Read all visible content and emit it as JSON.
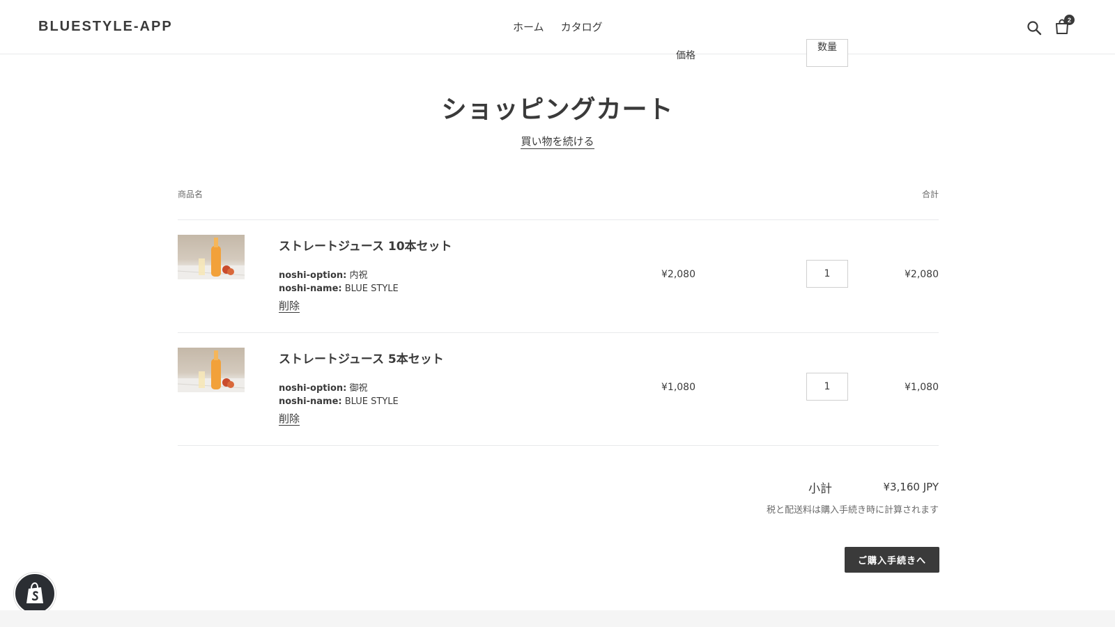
{
  "header": {
    "logo": "BLUESTYLE-APP",
    "nav": [
      "ホーム",
      "カタログ"
    ],
    "cart_count": "2",
    "icons": [
      "search-icon",
      "cart-icon"
    ]
  },
  "page": {
    "title": "ショッピングカート",
    "continue_link": "買い物を続ける"
  },
  "table": {
    "headers": {
      "name": "商品名",
      "price": "価格",
      "qty": "数量",
      "total": "合計"
    },
    "items": [
      {
        "name": "ストレートジュース 10本セット",
        "opt1_label": "noshi-option:",
        "opt1_value": "内祝",
        "opt2_label": "noshi-name:",
        "opt2_value": "BLUE STYLE",
        "remove": "削除",
        "price": "¥2,080",
        "qty": "1",
        "total": "¥2,080"
      },
      {
        "name": "ストレートジュース 5本セット",
        "opt1_label": "noshi-option:",
        "opt1_value": "御祝",
        "opt2_label": "noshi-name:",
        "opt2_value": "BLUE STYLE",
        "remove": "削除",
        "price": "¥1,080",
        "qty": "1",
        "total": "¥1,080"
      }
    ]
  },
  "summary": {
    "subtotal_label": "小計",
    "subtotal_value": "¥3,160 JPY",
    "tax_note": "税と配送料は購入手続き時に計算されます",
    "checkout_button": "ご購入手続きへ"
  },
  "colors": {
    "text": "#3a3a3a",
    "button_bg": "#3a3a3a",
    "divider": "#e8e9eb"
  }
}
